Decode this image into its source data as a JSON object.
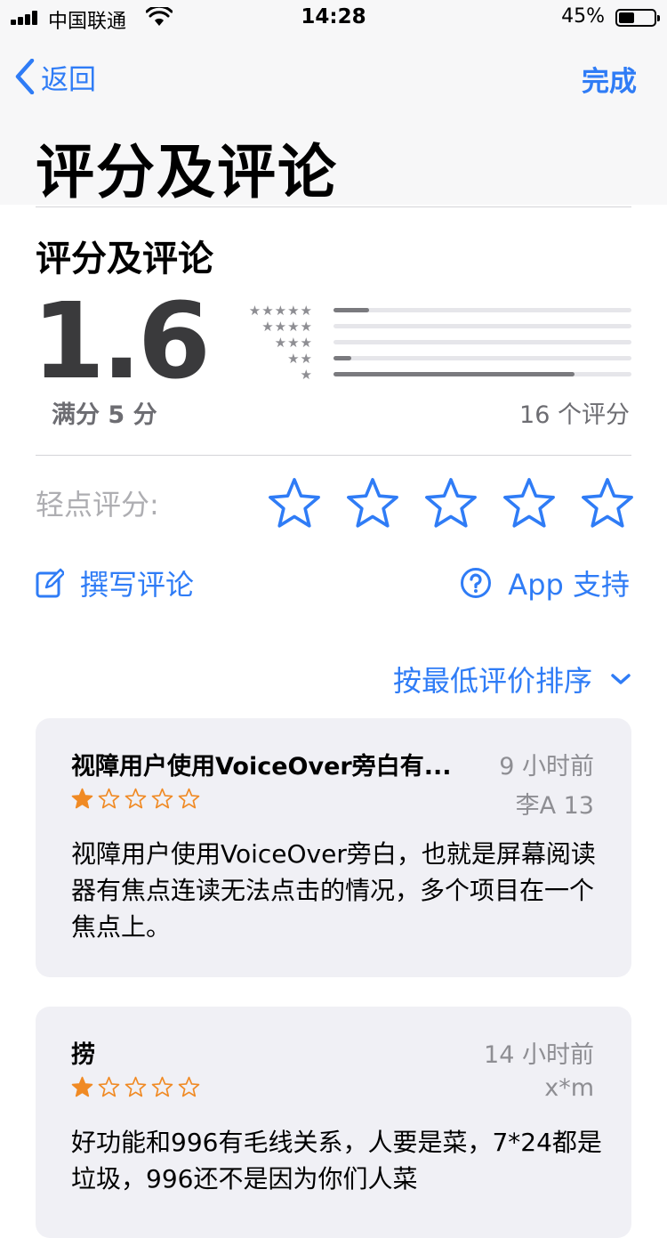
{
  "status_bar": {
    "carrier": "中国联通",
    "time": "14:28",
    "battery_pct": "45%",
    "battery_level": 0.45
  },
  "nav": {
    "back_label": "返回",
    "done_label": "完成",
    "large_title": "评分及评论"
  },
  "ratings": {
    "section_title": "评分及评论",
    "average": "1.6",
    "out_of": "满分 5 分",
    "count_label": "16 个评分",
    "histogram": [
      {
        "stars": "★★★★★",
        "fraction": 0.12
      },
      {
        "stars": "★★★★",
        "fraction": 0.0
      },
      {
        "stars": "★★★",
        "fraction": 0.0
      },
      {
        "stars": "★★",
        "fraction": 0.06
      },
      {
        "stars": "★",
        "fraction": 0.81
      }
    ]
  },
  "tap_to_rate": {
    "label": "轻点评分:",
    "star_count": 5
  },
  "actions": {
    "write_review": "撰写评论",
    "support": "App 支持"
  },
  "sort": {
    "label": "按最低评价排序"
  },
  "reviews": [
    {
      "title": "视障用户使用VoiceOver旁白有...",
      "time": "9 小时前",
      "author": "李A 13",
      "rating": 1,
      "body": "视障用户使用VoiceOver旁白，也就是屏幕阅读器有焦点连读无法点击的情况，多个项目在一个焦点上。"
    },
    {
      "title": "捞",
      "time": "14 小时前",
      "author": "x*m",
      "rating": 1,
      "body": "好功能和996有毛线关系，人要是菜，7*24都是垃圾，996还不是因为你们人菜"
    }
  ],
  "colors": {
    "accent": "#2f7cf6",
    "star_filled": "#f08a24",
    "star_empty": "#f08a24",
    "card_bg": "#f0f0f5"
  }
}
